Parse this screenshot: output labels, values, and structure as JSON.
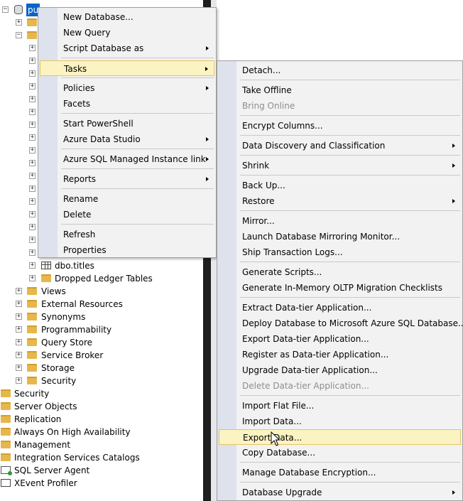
{
  "tree": {
    "database_label": "pu",
    "items": [
      {
        "label": "dbo.titles",
        "icon": "table-icon"
      },
      {
        "label": "Dropped Ledger Tables",
        "icon": "folder-icon"
      },
      {
        "label": "Views",
        "icon": "folder-icon"
      },
      {
        "label": "External Resources",
        "icon": "folder-icon"
      },
      {
        "label": "Synonyms",
        "icon": "folder-icon"
      },
      {
        "label": "Programmability",
        "icon": "folder-icon"
      },
      {
        "label": "Query Store",
        "icon": "folder-icon"
      },
      {
        "label": "Service Broker",
        "icon": "folder-icon"
      },
      {
        "label": "Storage",
        "icon": "folder-icon"
      },
      {
        "label": "Security",
        "icon": "folder-icon"
      },
      {
        "label": "Security",
        "icon": "folder-icon"
      },
      {
        "label": "Server Objects",
        "icon": "folder-icon"
      },
      {
        "label": "Replication",
        "icon": "folder-icon"
      },
      {
        "label": "Always On High Availability",
        "icon": "folder-icon"
      },
      {
        "label": "Management",
        "icon": "folder-icon"
      },
      {
        "label": "Integration Services Catalogs",
        "icon": "folder-icon"
      },
      {
        "label": "SQL Server Agent",
        "icon": "agent-icon"
      },
      {
        "label": "XEvent Profiler",
        "icon": "xevent-icon"
      }
    ]
  },
  "context_menu": {
    "items": [
      {
        "label": "New Database..."
      },
      {
        "label": "New Query"
      },
      {
        "label": "Script Database as"
      },
      {
        "label": "Tasks"
      },
      {
        "label": "Policies"
      },
      {
        "label": "Facets"
      },
      {
        "label": "Start PowerShell"
      },
      {
        "label": "Azure Data Studio"
      },
      {
        "label": "Azure SQL Managed Instance link"
      },
      {
        "label": "Reports"
      },
      {
        "label": "Rename"
      },
      {
        "label": "Delete"
      },
      {
        "label": "Refresh"
      },
      {
        "label": "Properties"
      }
    ]
  },
  "tasks_menu": {
    "items": [
      {
        "label": "Detach..."
      },
      {
        "label": "Take Offline"
      },
      {
        "label": "Bring Online",
        "disabled": true
      },
      {
        "label": "Encrypt Columns..."
      },
      {
        "label": "Data Discovery and Classification"
      },
      {
        "label": "Shrink"
      },
      {
        "label": "Back Up..."
      },
      {
        "label": "Restore"
      },
      {
        "label": "Mirror..."
      },
      {
        "label": "Launch Database Mirroring Monitor..."
      },
      {
        "label": "Ship Transaction Logs..."
      },
      {
        "label": "Generate Scripts..."
      },
      {
        "label": "Generate In-Memory OLTP Migration Checklists"
      },
      {
        "label": "Extract Data-tier Application..."
      },
      {
        "label": "Deploy Database to Microsoft Azure SQL Database..."
      },
      {
        "label": "Export Data-tier Application..."
      },
      {
        "label": "Register as Data-tier Application..."
      },
      {
        "label": "Upgrade Data-tier Application..."
      },
      {
        "label": "Delete Data-tier Application...",
        "disabled": true
      },
      {
        "label": "Import Flat File..."
      },
      {
        "label": "Import Data..."
      },
      {
        "label": "Export Data..."
      },
      {
        "label": "Copy Database..."
      },
      {
        "label": "Manage Database Encryption..."
      },
      {
        "label": "Database Upgrade"
      }
    ]
  },
  "colors": {
    "highlight": "#fcf3c2",
    "highlight_border": "#e5c365",
    "menu_background": "#f2f2f2",
    "menu_gutter": "#dde2ec",
    "selection": "#0a64c8"
  }
}
